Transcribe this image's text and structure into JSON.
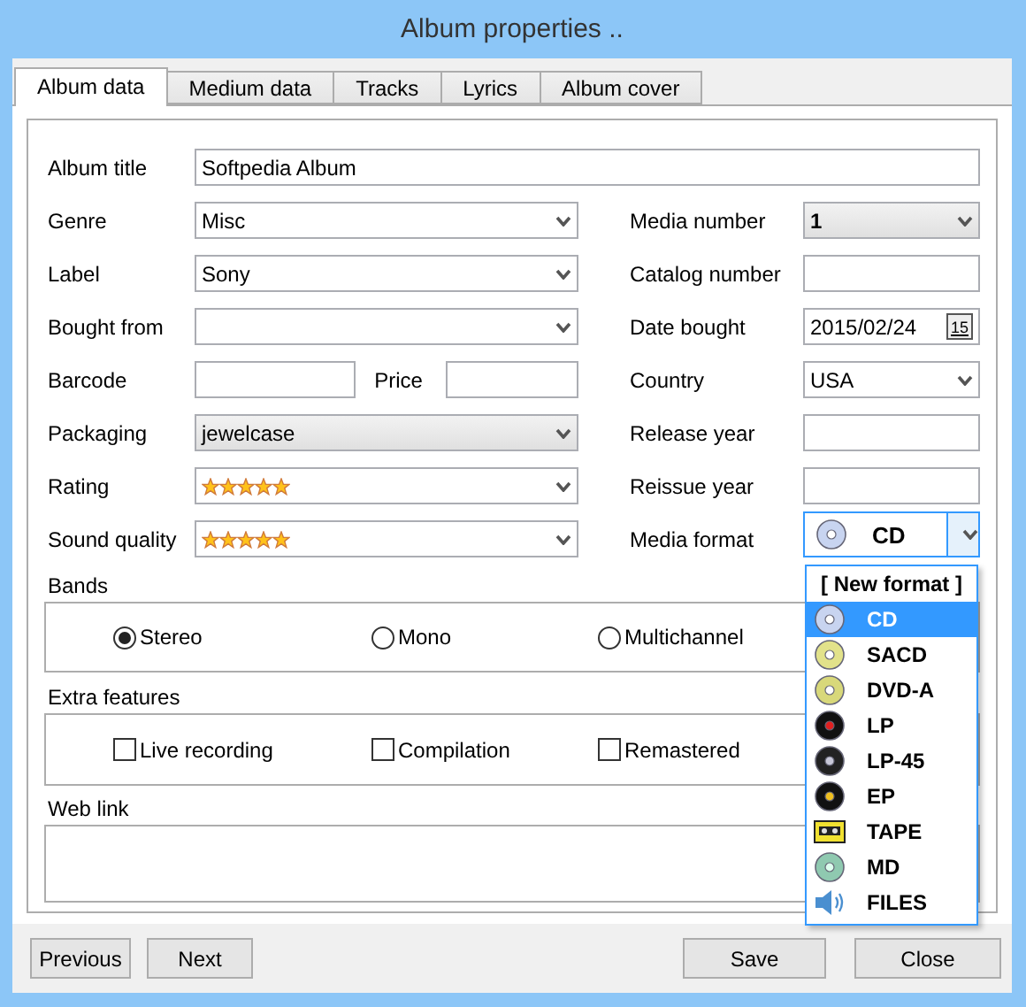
{
  "window": {
    "title": "Album properties .."
  },
  "tabs": [
    {
      "label": "Album data",
      "selected": true
    },
    {
      "label": "Medium data",
      "selected": false
    },
    {
      "label": "Tracks",
      "selected": false
    },
    {
      "label": "Lyrics",
      "selected": false
    },
    {
      "label": "Album cover",
      "selected": false
    }
  ],
  "album_title": {
    "label": "Album title",
    "value": "Softpedia Album"
  },
  "form": {
    "left": [
      {
        "kind": "combo",
        "label": "Genre",
        "value": "Misc"
      },
      {
        "kind": "combo",
        "label": "Label",
        "value": "Sony"
      },
      {
        "kind": "combo",
        "label": "Bought from"
      },
      {
        "kind": "pair",
        "label": "Barcode",
        "second_label": "Price"
      },
      {
        "kind": "list",
        "label": "Packaging",
        "value": "jewelcase"
      },
      {
        "kind": "stars",
        "label": "Rating",
        "stars": 5
      },
      {
        "kind": "stars",
        "label": "Sound quality",
        "stars": 5
      }
    ],
    "right": [
      {
        "kind": "list",
        "label": "Media number",
        "value": "1",
        "bold": true
      },
      {
        "kind": "text",
        "label": "Catalog number"
      },
      {
        "kind": "date",
        "label": "Date bought",
        "value": "2015/02/24",
        "calendar_day": "15"
      },
      {
        "kind": "combo",
        "label": "Country",
        "value": "USA"
      },
      {
        "kind": "text",
        "label": "Release year"
      },
      {
        "kind": "text",
        "label": "Reissue year"
      },
      {
        "kind": "media",
        "label": "Media format",
        "value": "CD"
      }
    ]
  },
  "bands": {
    "label": "Bands",
    "options": [
      {
        "label": "Stereo",
        "selected": true
      },
      {
        "label": "Mono",
        "selected": false
      },
      {
        "label": "Multichannel",
        "selected": false
      }
    ]
  },
  "extra_features": {
    "label": "Extra features",
    "options": [
      {
        "label": "Live recording",
        "checked": false
      },
      {
        "label": "Compilation",
        "checked": false
      },
      {
        "label": "Remastered",
        "checked": false
      }
    ]
  },
  "web_link": {
    "label": "Web link"
  },
  "nav_buttons": [
    "Previous",
    "Next"
  ],
  "action_buttons": [
    "Save",
    "Close"
  ],
  "media_format_list": {
    "header": "[ New format ]",
    "items": [
      {
        "kind": "cd",
        "label": "CD",
        "selected": true
      },
      {
        "kind": "sacd",
        "label": "SACD",
        "selected": false
      },
      {
        "kind": "dvd",
        "label": "DVD-A",
        "selected": false
      },
      {
        "kind": "lp",
        "label": "LP",
        "selected": false
      },
      {
        "kind": "lp45",
        "label": "LP-45",
        "selected": false
      },
      {
        "kind": "ep",
        "label": "EP",
        "selected": false
      },
      {
        "kind": "tape",
        "label": "TAPE",
        "selected": false
      },
      {
        "kind": "md",
        "label": "MD",
        "selected": false
      },
      {
        "kind": "files",
        "label": "FILES",
        "selected": false
      }
    ]
  }
}
